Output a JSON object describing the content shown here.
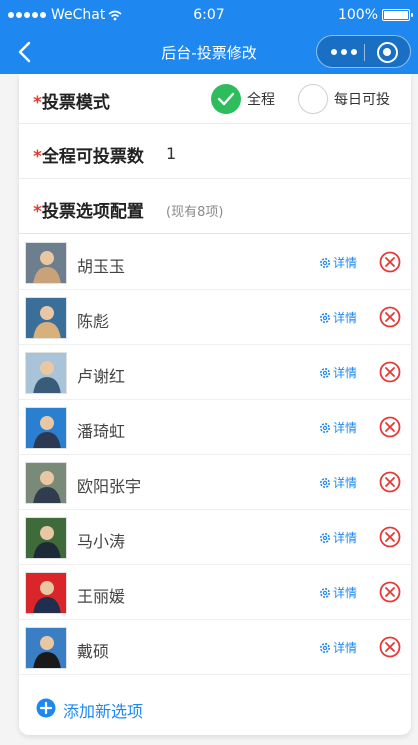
{
  "status_bar": {
    "carrier": "WeChat",
    "time": "6:07",
    "battery": "100%",
    "battery_level": 1.0
  },
  "nav": {
    "title": "后台-投票修改"
  },
  "form": {
    "mode": {
      "label": "投票模式",
      "options": [
        "全程",
        "每日可投"
      ],
      "selected": "全程"
    },
    "total_votes": {
      "label": "全程可投票数",
      "value": "1"
    },
    "options_config": {
      "label": "投票选项配置",
      "count_note": "(现有8项)"
    }
  },
  "items": [
    {
      "name": "胡玉玉",
      "detail_label": "详情",
      "photo_bg": "#6d7f8f",
      "figure": "#c9a27a"
    },
    {
      "name": "陈彪",
      "detail_label": "详情",
      "photo_bg": "#3a6f9a",
      "figure": "#d8b07c"
    },
    {
      "name": "卢谢红",
      "detail_label": "详情",
      "photo_bg": "#a9c4d8",
      "figure": "#3a5b7a"
    },
    {
      "name": "潘琦虹",
      "detail_label": "详情",
      "photo_bg": "#2a7fd0",
      "figure": "#2b3a52"
    },
    {
      "name": "欧阳张宇",
      "detail_label": "详情",
      "photo_bg": "#7a8a78",
      "figure": "#2f3d4e"
    },
    {
      "name": "马小涛",
      "detail_label": "详情",
      "photo_bg": "#3f6b3a",
      "figure": "#1f2a38"
    },
    {
      "name": "王丽媛",
      "detail_label": "详情",
      "photo_bg": "#d8262a",
      "figure": "#1f2f4d"
    },
    {
      "name": "戴硕",
      "detail_label": "详情",
      "photo_bg": "#3a7ec4",
      "figure": "#1a1a1a"
    }
  ],
  "add_button": {
    "label": "添加新选项"
  },
  "icons": {
    "back": "chevron-left-icon",
    "more": "more-dots-icon",
    "close_app": "target-icon",
    "check": "check-icon",
    "detail": "gear-icon",
    "delete": "close-circle-icon",
    "add": "plus-circle-icon"
  },
  "colors": {
    "primary": "#1e88f0",
    "checked": "#2ebd5c",
    "delete": "#e53935",
    "required": "#e53935"
  }
}
